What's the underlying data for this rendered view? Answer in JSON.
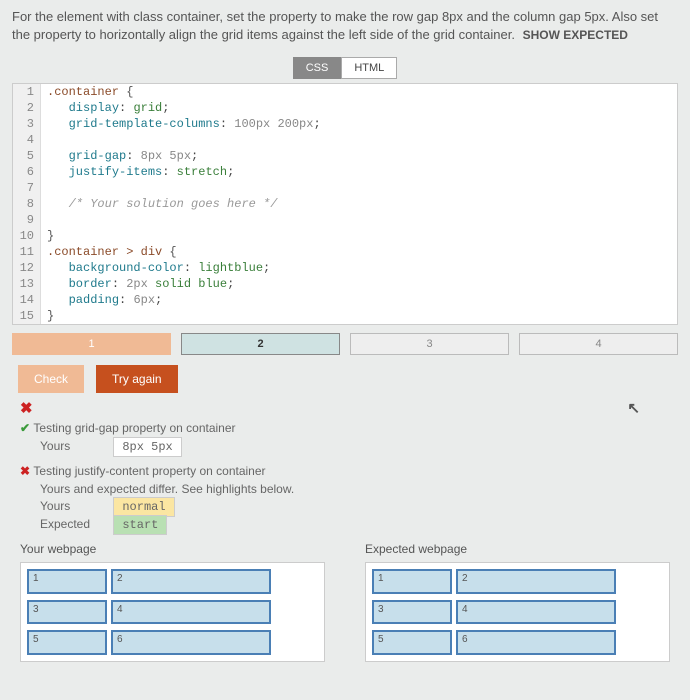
{
  "instructions": {
    "text": "For the element with class container, set the property to make the row gap 8px and the column gap 5px. Also set the property to horizontally align the grid items against the left side of the grid container.",
    "show_expected": "SHOW EXPECTED"
  },
  "tabs": {
    "css": "CSS",
    "html": "HTML",
    "active": "css"
  },
  "code": {
    "lines": [
      {
        "n": 1,
        "html": "<span class='sel'>.container</span> <span class='brace'>{</span>"
      },
      {
        "n": 2,
        "html": "   <span class='prop'>display</span>: <span class='kw'>grid</span>;"
      },
      {
        "n": 3,
        "html": "   <span class='prop'>grid-template-columns</span>: <span class='val'>100px 200px</span>;"
      },
      {
        "n": 4,
        "html": ""
      },
      {
        "n": 5,
        "html": "   <span class='prop'>grid-gap</span>: <span class='val'>8px 5px</span>;"
      },
      {
        "n": 6,
        "html": "   <span class='prop'>justify-items</span>: <span class='kw'>stretch</span>;"
      },
      {
        "n": 7,
        "html": ""
      },
      {
        "n": 8,
        "html": "   <span class='cmt'>/* Your solution goes here */</span>"
      },
      {
        "n": 9,
        "html": ""
      },
      {
        "n": 10,
        "html": "<span class='brace'>}</span>"
      },
      {
        "n": 11,
        "html": "<span class='sel'>.container > div</span> <span class='brace'>{</span>"
      },
      {
        "n": 12,
        "html": "   <span class='prop'>background-color</span>: <span class='kw'>lightblue</span>;"
      },
      {
        "n": 13,
        "html": "   <span class='prop'>border</span>: <span class='val'>2px</span> <span class='kw'>solid blue</span>;"
      },
      {
        "n": 14,
        "html": "   <span class='prop'>padding</span>: <span class='val'>6px</span>;"
      },
      {
        "n": 15,
        "html": "<span class='brace'>}</span>"
      }
    ]
  },
  "steps": [
    "1",
    "2",
    "3",
    "4"
  ],
  "buttons": {
    "check": "Check",
    "try": "Try again"
  },
  "status": {
    "x": "✖"
  },
  "results": {
    "test1": {
      "title": "Testing grid-gap property on container",
      "yours_label": "Yours",
      "yours_value": "8px 5px"
    },
    "test2": {
      "title": "Testing justify-content property on container",
      "diff": "Yours and expected differ. See highlights below.",
      "yours_label": "Yours",
      "yours_value": "normal",
      "expected_label": "Expected",
      "expected_value": "start"
    }
  },
  "preview": {
    "your_title": "Your webpage",
    "expected_title": "Expected webpage",
    "cells": [
      "1",
      "2",
      "3",
      "4",
      "5",
      "6"
    ]
  }
}
